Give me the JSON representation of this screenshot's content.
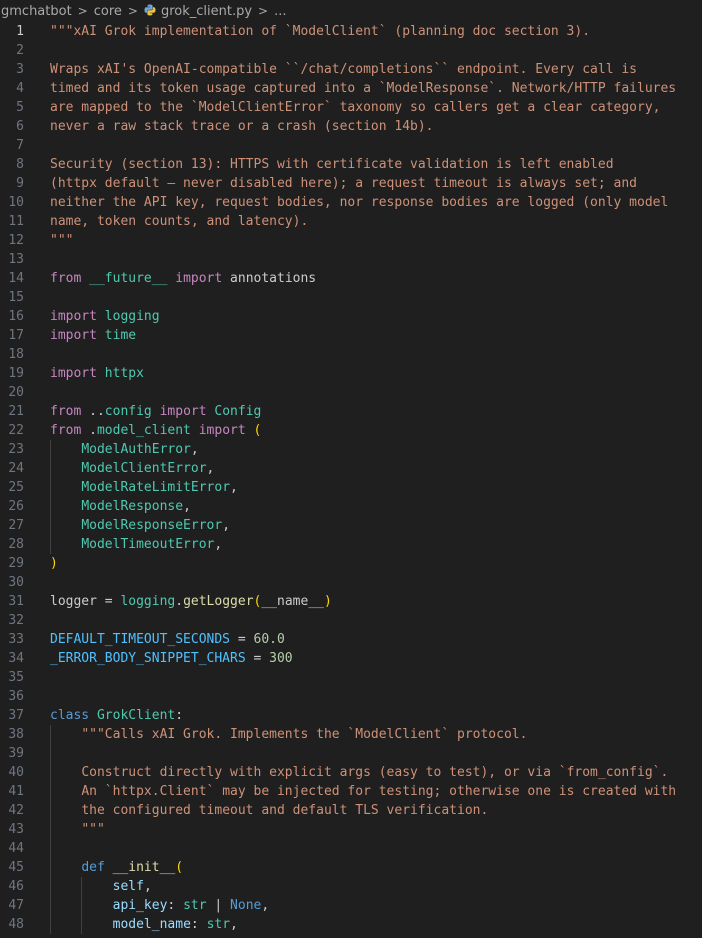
{
  "breadcrumb": {
    "items": [
      "gmchatbot",
      "core",
      "grok_client.py",
      "..."
    ],
    "separator": ">"
  },
  "editor": {
    "language": "python",
    "active_line": 1,
    "lines": [
      {
        "n": "1",
        "tokens": [
          [
            "doc",
            "\"\"\"xAI Grok implementation of `ModelClient` (planning doc section 3)."
          ]
        ]
      },
      {
        "n": "2",
        "tokens": []
      },
      {
        "n": "3",
        "tokens": [
          [
            "doc",
            "Wraps xAI's OpenAI-compatible ``/chat/completions`` endpoint. Every call is"
          ]
        ]
      },
      {
        "n": "4",
        "tokens": [
          [
            "doc",
            "timed and its token usage captured into a `ModelResponse`. Network/HTTP failures"
          ]
        ]
      },
      {
        "n": "5",
        "tokens": [
          [
            "doc",
            "are mapped to the `ModelClientError` taxonomy so callers get a clear category,"
          ]
        ]
      },
      {
        "n": "6",
        "tokens": [
          [
            "doc",
            "never a raw stack trace or a crash (section 14b)."
          ]
        ]
      },
      {
        "n": "7",
        "tokens": []
      },
      {
        "n": "8",
        "tokens": [
          [
            "doc",
            "Security (section 13): HTTPS with certificate validation is left enabled"
          ]
        ]
      },
      {
        "n": "9",
        "tokens": [
          [
            "doc",
            "(httpx default — never disabled here); a request timeout is always set; and"
          ]
        ]
      },
      {
        "n": "10",
        "tokens": [
          [
            "doc",
            "neither the API key, request bodies, nor response bodies are logged (only model"
          ]
        ]
      },
      {
        "n": "11",
        "tokens": [
          [
            "doc",
            "name, token counts, and latency)."
          ]
        ]
      },
      {
        "n": "12",
        "tokens": [
          [
            "doc",
            "\"\"\""
          ]
        ]
      },
      {
        "n": "13",
        "tokens": []
      },
      {
        "n": "14",
        "tokens": [
          [
            "kw",
            "from"
          ],
          [
            "plain",
            " "
          ],
          [
            "cls",
            "__future__"
          ],
          [
            "plain",
            " "
          ],
          [
            "kw",
            "import"
          ],
          [
            "plain",
            " annotations"
          ]
        ]
      },
      {
        "n": "15",
        "tokens": []
      },
      {
        "n": "16",
        "tokens": [
          [
            "kw",
            "import"
          ],
          [
            "plain",
            " "
          ],
          [
            "cls",
            "logging"
          ]
        ]
      },
      {
        "n": "17",
        "tokens": [
          [
            "kw",
            "import"
          ],
          [
            "plain",
            " "
          ],
          [
            "cls",
            "time"
          ]
        ]
      },
      {
        "n": "18",
        "tokens": []
      },
      {
        "n": "19",
        "tokens": [
          [
            "kw",
            "import"
          ],
          [
            "plain",
            " "
          ],
          [
            "cls",
            "httpx"
          ]
        ]
      },
      {
        "n": "20",
        "tokens": []
      },
      {
        "n": "21",
        "tokens": [
          [
            "kw",
            "from"
          ],
          [
            "plain",
            " .."
          ],
          [
            "cls",
            "config"
          ],
          [
            "plain",
            " "
          ],
          [
            "kw",
            "import"
          ],
          [
            "plain",
            " "
          ],
          [
            "cls",
            "Config"
          ]
        ]
      },
      {
        "n": "22",
        "tokens": [
          [
            "kw",
            "from"
          ],
          [
            "plain",
            " ."
          ],
          [
            "cls",
            "model_client"
          ],
          [
            "plain",
            " "
          ],
          [
            "kw",
            "import"
          ],
          [
            "plain",
            " "
          ],
          [
            "brk1",
            "("
          ]
        ]
      },
      {
        "n": "23",
        "indent": 1,
        "tokens": [
          [
            "plain",
            "    "
          ],
          [
            "cls",
            "ModelAuthError"
          ],
          [
            "plain",
            ","
          ]
        ]
      },
      {
        "n": "24",
        "indent": 1,
        "tokens": [
          [
            "plain",
            "    "
          ],
          [
            "cls",
            "ModelClientError"
          ],
          [
            "plain",
            ","
          ]
        ]
      },
      {
        "n": "25",
        "indent": 1,
        "tokens": [
          [
            "plain",
            "    "
          ],
          [
            "cls",
            "ModelRateLimitError"
          ],
          [
            "plain",
            ","
          ]
        ]
      },
      {
        "n": "26",
        "indent": 1,
        "tokens": [
          [
            "plain",
            "    "
          ],
          [
            "cls",
            "ModelResponse"
          ],
          [
            "plain",
            ","
          ]
        ]
      },
      {
        "n": "27",
        "indent": 1,
        "tokens": [
          [
            "plain",
            "    "
          ],
          [
            "cls",
            "ModelResponseError"
          ],
          [
            "plain",
            ","
          ]
        ]
      },
      {
        "n": "28",
        "indent": 1,
        "tokens": [
          [
            "plain",
            "    "
          ],
          [
            "cls",
            "ModelTimeoutError"
          ],
          [
            "plain",
            ","
          ]
        ]
      },
      {
        "n": "29",
        "tokens": [
          [
            "brk1",
            ")"
          ]
        ]
      },
      {
        "n": "30",
        "tokens": []
      },
      {
        "n": "31",
        "tokens": [
          [
            "plain",
            "logger = "
          ],
          [
            "cls",
            "logging"
          ],
          [
            "plain",
            "."
          ],
          [
            "fn",
            "getLogger"
          ],
          [
            "brk1",
            "("
          ],
          [
            "plain",
            "__name__"
          ],
          [
            "brk1",
            ")"
          ]
        ]
      },
      {
        "n": "32",
        "tokens": []
      },
      {
        "n": "33",
        "tokens": [
          [
            "const",
            "DEFAULT_TIMEOUT_SECONDS"
          ],
          [
            "plain",
            " = "
          ],
          [
            "num",
            "60.0"
          ]
        ]
      },
      {
        "n": "34",
        "tokens": [
          [
            "const",
            "_ERROR_BODY_SNIPPET_CHARS"
          ],
          [
            "plain",
            " = "
          ],
          [
            "num",
            "300"
          ]
        ]
      },
      {
        "n": "35",
        "tokens": []
      },
      {
        "n": "36",
        "tokens": []
      },
      {
        "n": "37",
        "tokens": [
          [
            "def",
            "class"
          ],
          [
            "plain",
            " "
          ],
          [
            "cls",
            "GrokClient"
          ],
          [
            "plain",
            ":"
          ]
        ]
      },
      {
        "n": "38",
        "indent": 1,
        "tokens": [
          [
            "plain",
            "    "
          ],
          [
            "doc",
            "\"\"\"Calls xAI Grok. Implements the `ModelClient` protocol."
          ]
        ]
      },
      {
        "n": "39",
        "indent": 1,
        "tokens": []
      },
      {
        "n": "40",
        "indent": 1,
        "tokens": [
          [
            "plain",
            "    "
          ],
          [
            "doc",
            "Construct directly with explicit args (easy to test), or via `from_config`."
          ]
        ]
      },
      {
        "n": "41",
        "indent": 1,
        "tokens": [
          [
            "plain",
            "    "
          ],
          [
            "doc",
            "An `httpx.Client` may be injected for testing; otherwise one is created with"
          ]
        ]
      },
      {
        "n": "42",
        "indent": 1,
        "tokens": [
          [
            "plain",
            "    "
          ],
          [
            "doc",
            "the configured timeout and default TLS verification."
          ]
        ]
      },
      {
        "n": "43",
        "indent": 1,
        "tokens": [
          [
            "plain",
            "    "
          ],
          [
            "doc",
            "\"\"\""
          ]
        ]
      },
      {
        "n": "44",
        "indent": 1,
        "tokens": []
      },
      {
        "n": "45",
        "indent": 1,
        "tokens": [
          [
            "plain",
            "    "
          ],
          [
            "def",
            "def"
          ],
          [
            "plain",
            " "
          ],
          [
            "fn",
            "__init__"
          ],
          [
            "brk1",
            "("
          ]
        ]
      },
      {
        "n": "46",
        "indent": 2,
        "tokens": [
          [
            "plain",
            "        "
          ],
          [
            "var",
            "self"
          ],
          [
            "plain",
            ","
          ]
        ]
      },
      {
        "n": "47",
        "indent": 2,
        "tokens": [
          [
            "plain",
            "        "
          ],
          [
            "var",
            "api_key"
          ],
          [
            "plain",
            ": "
          ],
          [
            "cls",
            "str"
          ],
          [
            "plain",
            " | "
          ],
          [
            "def",
            "None"
          ],
          [
            "plain",
            ","
          ]
        ]
      },
      {
        "n": "48",
        "indent": 2,
        "tokens": [
          [
            "plain",
            "        "
          ],
          [
            "var",
            "model_name"
          ],
          [
            "plain",
            ": "
          ],
          [
            "cls",
            "str"
          ],
          [
            "plain",
            ","
          ]
        ]
      }
    ]
  }
}
